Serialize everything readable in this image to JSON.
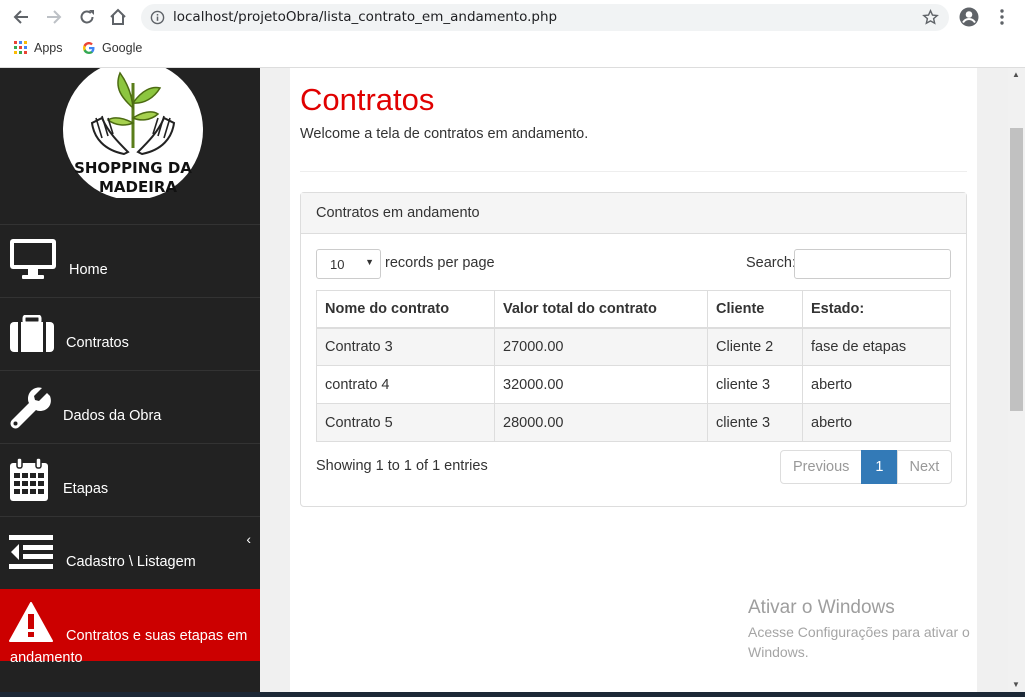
{
  "browser": {
    "url": "localhost/projetoObra/lista_contrato_em_andamento.php",
    "bookmarks": [
      {
        "label": "Apps",
        "icon": "apps-grid-icon"
      },
      {
        "label": "Google",
        "icon": "google-g-icon"
      }
    ]
  },
  "sidebar": {
    "logo_text_line1": "SHOPPING DA",
    "logo_text_line2": "MADEIRA",
    "items": [
      {
        "label": "Home",
        "icon": "monitor-icon"
      },
      {
        "label": "Contratos",
        "icon": "briefcase-icon"
      },
      {
        "label": "Dados da Obra",
        "icon": "wrench-icon"
      },
      {
        "label": "Etapas",
        "icon": "calendar-icon"
      },
      {
        "label": "Cadastro \\ Listagem",
        "icon": "outdent-icon"
      },
      {
        "label": "Contratos e suas etapas em andamento",
        "icon": "warning-icon"
      }
    ],
    "active_color": "#cc0000"
  },
  "main": {
    "title": "Contratos",
    "subtitle": "Welcome a tela de contratos em andamento.",
    "panel_title": "Contratos em andamento",
    "length_value": "10",
    "length_label": "records per page",
    "search_label": "Search:",
    "columns": [
      "Nome do contrato",
      "Valor total do contrato",
      "Cliente",
      "Estado:"
    ],
    "rows": [
      [
        "Contrato 3",
        "27000.00",
        "Cliente 2",
        "fase de etapas"
      ],
      [
        "contrato 4",
        "32000.00",
        "cliente 3",
        "aberto"
      ],
      [
        "Contrato 5",
        "28000.00",
        "cliente 3",
        "aberto"
      ]
    ],
    "info": "Showing 1 to 1 of 1 entries",
    "pagination": {
      "previous": "Previous",
      "current": "1",
      "next": "Next"
    },
    "title_color": "#e00000",
    "page_active_color": "#337ab7"
  },
  "watermark": {
    "title": "Ativar o Windows",
    "text": "Acesse Configurações para ativar o Windows."
  }
}
